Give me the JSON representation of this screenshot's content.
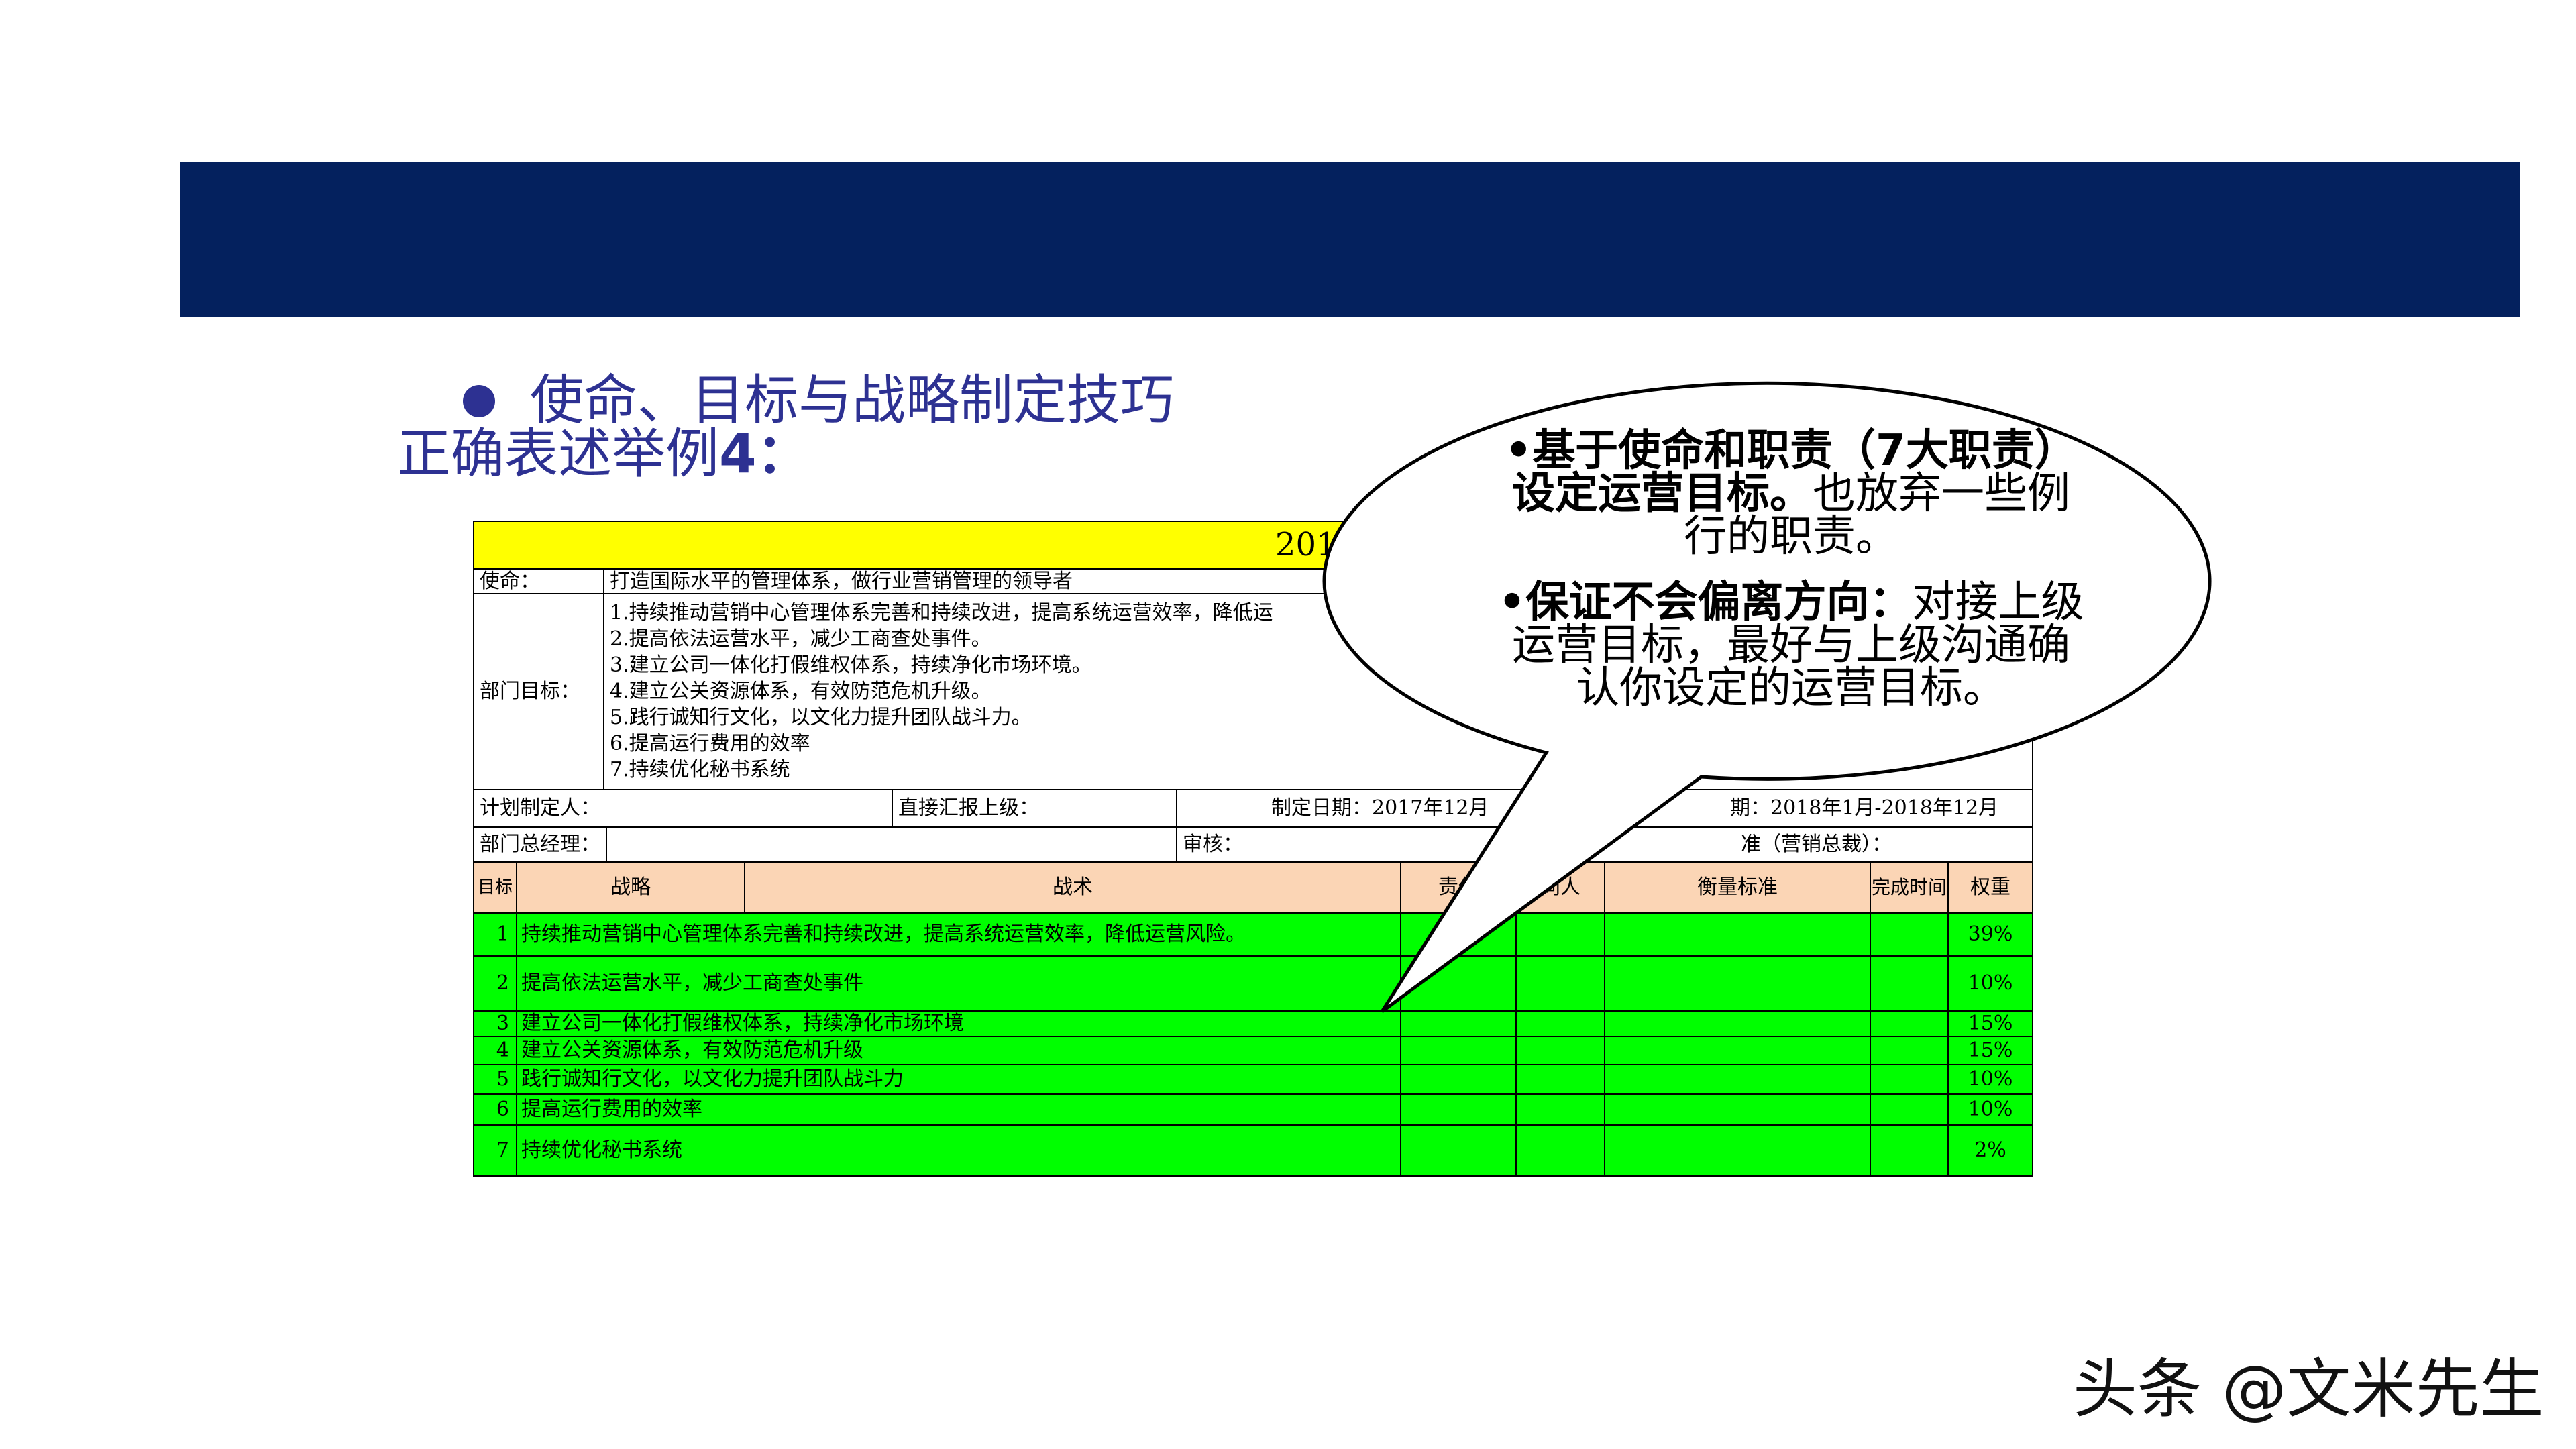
{
  "heading": {
    "title": "使命、目标与战略制定技巧",
    "subtitle_text": "正确表述举例",
    "subtitle_num": "4："
  },
  "sheet": {
    "title": "2018年综合管理总部年度",
    "mission_label": "使命：",
    "mission_value": "打造国际水平的管理体系，做行业营销管理的领导者",
    "dept_goals_label": "部门目标：",
    "dept_goals": [
      "1.持续推动营销中心管理体系完善和持续改进，提高系统运营效率，降低运",
      "2.提高依法运营水平，减少工商查处事件。",
      "3.建立公司一体化打假维权体系，持续净化市场环境。",
      "4.建立公关资源体系，有效防范危机升级。",
      "5.践行诚知行文化，以文化力提升团队战斗力。",
      "6.提高运行费用的效率",
      "7.持续优化秘书系统"
    ],
    "planner_label": "计划制定人：",
    "report_label": "直接汇报上级：",
    "date_label": "制定日期：2017年12月",
    "period_label": "期：2018年1月-2018年12月",
    "gm_label": "部门总经理：",
    "review_label": "审核：",
    "approve_label": "准（营销总裁）：",
    "headers": {
      "target": "目标",
      "strategy": "战略",
      "tactics": "战术",
      "owner": "责任",
      "helper": "同人",
      "measure": "衡量标准",
      "deadline": "完成时间",
      "weight": "权重"
    },
    "rows": [
      {
        "no": "1",
        "strategy": "持续推动营销中心管理体系完善和持续改进，提高系统运营效率，降低运营风险。",
        "weight": "39%"
      },
      {
        "no": "2",
        "strategy": "提高依法运营水平，减少工商查处事件",
        "weight": "10%"
      },
      {
        "no": "3",
        "strategy": "建立公司一体化打假维权体系，持续净化市场环境",
        "weight": "15%"
      },
      {
        "no": "4",
        "strategy": "建立公关资源体系，有效防范危机升级",
        "weight": "15%"
      },
      {
        "no": "5",
        "strategy": "践行诚知行文化，以文化力提升团队战斗力",
        "weight": "10%"
      },
      {
        "no": "6",
        "strategy": "提高运行费用的效率",
        "weight": "10%"
      },
      {
        "no": "7",
        "strategy": "持续优化秘书系统",
        "weight": "2%"
      }
    ]
  },
  "bubble": {
    "p1_bold": "•基于使命和职责（7大职责）设定运营目标。",
    "p1_line1": "•基于使命和职责（7大职责）",
    "p1_line2_bold": "设定运营目标。",
    "p1_line2_rest": "也放弃一些例",
    "p1_line3": "行的职责。",
    "p2_line1_bold": "•保证不会偏离方向：",
    "p2_line1_rest": "对接上级",
    "p2_line2": "运营目标，最好与上级沟通确",
    "p2_line3": "认你设定的运营目标。"
  },
  "watermark": "头条 @文米先生",
  "colors": {
    "banner": "#04215e",
    "heading": "#2d3192",
    "sheet_title_bg": "#ffff00",
    "header_bg": "#fbd5b5",
    "rows_bg": "#00ff00"
  }
}
